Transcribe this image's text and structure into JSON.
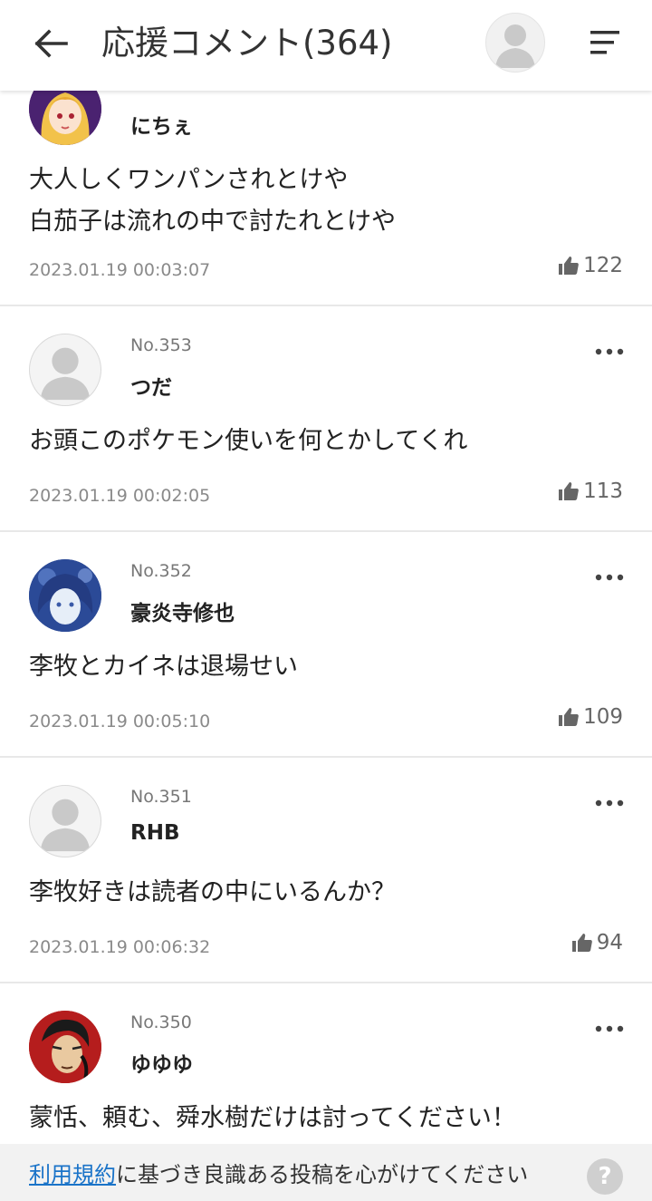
{
  "header": {
    "title": "応援コメント(364)",
    "back_icon": "arrow-left-icon",
    "menu_icon": "sort-lines-icon"
  },
  "comments": [
    {
      "no": "",
      "name": "にちぇ",
      "body": "大人しくワンパンされとけや\n白茄子は流れの中で討たれとけや",
      "date": "2023.01.19 00:03:07",
      "likes": "122",
      "avatar": "illustrated-blonde-avatar"
    },
    {
      "no": "No.353",
      "name": "つだ",
      "body": "お頭このポケモン使いを何とかしてくれ",
      "date": "2023.01.19 00:02:05",
      "likes": "113",
      "avatar": "default-avatar"
    },
    {
      "no": "No.352",
      "name": "豪炎寺修也",
      "body": "李牧とカイネは退場せい",
      "date": "2023.01.19 00:05:10",
      "likes": "109",
      "avatar": "illustrated-blue-avatar"
    },
    {
      "no": "No.351",
      "name": "RHB",
      "body": "李牧好きは読者の中にいるんか？",
      "date": "2023.01.19 00:06:32",
      "likes": "94",
      "avatar": "default-avatar"
    },
    {
      "no": "No.350",
      "name": "ゆゆゆ",
      "body": "蒙恬、頼む、舜水樹だけは討ってください！",
      "date": "",
      "likes": "",
      "avatar": "illustrated-red-avatar"
    }
  ],
  "footer": {
    "link_text": "利用規約",
    "text": "に基づき良識ある投稿を心がけてください",
    "help_label": "?"
  },
  "colors": {
    "link": "#1a73c8",
    "divider": "#e8e8e8",
    "footer_bg": "#f2f2f2"
  }
}
